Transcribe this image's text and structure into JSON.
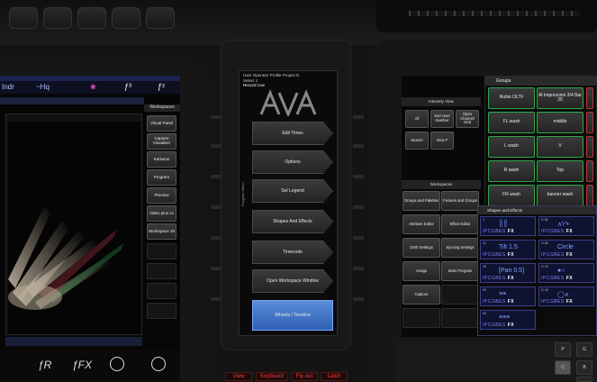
{
  "left_screen": {
    "top_tabs": [
      "Indr",
      "~Hq",
      "",
      "❀",
      "ƒ³",
      "ƒ²"
    ],
    "workspace_title": "Workspaces",
    "workspace_buttons": [
      "Visual Panel",
      "Capture Visualiser",
      "Karluson",
      "Program",
      "Preview",
      "Video plus cu",
      "Workspace 19"
    ],
    "fx_controls": [
      "ƒR",
      "ƒFX"
    ]
  },
  "center_screen": {
    "header": "User Operator Profile Project D",
    "tree": [
      "Select 1",
      "Record Cue"
    ],
    "side_label": "Program Menu",
    "menu_buttons": [
      "Edit Times",
      "Options",
      "Set Legend",
      "Shapes And Effects",
      "Timecode",
      "Open Workspace Window",
      "Wheels / Timeline"
    ],
    "hw_buttons": [
      "View",
      "Keyboard",
      "Fly-out",
      "Latch"
    ]
  },
  "intensity_view": {
    "title": "Intensity View",
    "buttons": [
      "All",
      "Sort User Number",
      "Open Channel Grid",
      "Search",
      "View F"
    ]
  },
  "workspace_right": {
    "title": "Workspaces",
    "buttons": [
      "Groups and Palettes",
      "Fixtures and Groups",
      "Attribute Editor",
      "Effect Editor",
      "DMX Settings",
      "Syncing Settings",
      "Assign",
      "Main Program",
      "Capture"
    ]
  },
  "groups": {
    "title": "Groups",
    "items": [
      "Rubin OLTF",
      "Al Impression 3/4 Bar 20",
      "FL wash",
      "middle",
      "L wash",
      "V",
      "R wash",
      "Top",
      "FR wash",
      "banner wash"
    ]
  },
  "shapes_effects": {
    "title": "Shapes and Effects",
    "cells": [
      {
        "num": "2",
        "glyph": "║║",
        "label": "IPCGBES",
        "fx": "FX"
      },
      {
        "num": "G 65",
        "glyph": "∧\\↷",
        "label": "IPCGBES",
        "fx": "FX"
      },
      {
        "num": "31",
        "glyph": "Tilt 1.5",
        "label": "IPCGBES",
        "fx": "FX"
      },
      {
        "num": "G 65",
        "glyph": "Circle",
        "label": "IPCGBES",
        "fx": "FX"
      },
      {
        "num": "49",
        "glyph": "[Pan 0.5]",
        "label": "IPCGBES",
        "fx": "FX"
      },
      {
        "num": "G 45",
        "glyph": "●○",
        "label": "IPCGBES",
        "fx": "FX"
      },
      {
        "num": "50",
        "glyph": "≡≡",
        "label": "IPCGBES",
        "fx": "FX"
      },
      {
        "num": "G 45",
        "glyph": "◯∧",
        "label": "IPCGBES",
        "fx": "FX"
      },
      {
        "num": "64",
        "glyph": "≡≡≡",
        "label": "IPCGBES",
        "fx": "FX"
      }
    ]
  },
  "bottom_keys": [
    "P",
    "G",
    "C",
    "B",
    "X"
  ],
  "colors": {
    "accent_blue": "#3a6ccc",
    "group_border": "#2fa84a",
    "red_btn": "#ff3b3b"
  }
}
